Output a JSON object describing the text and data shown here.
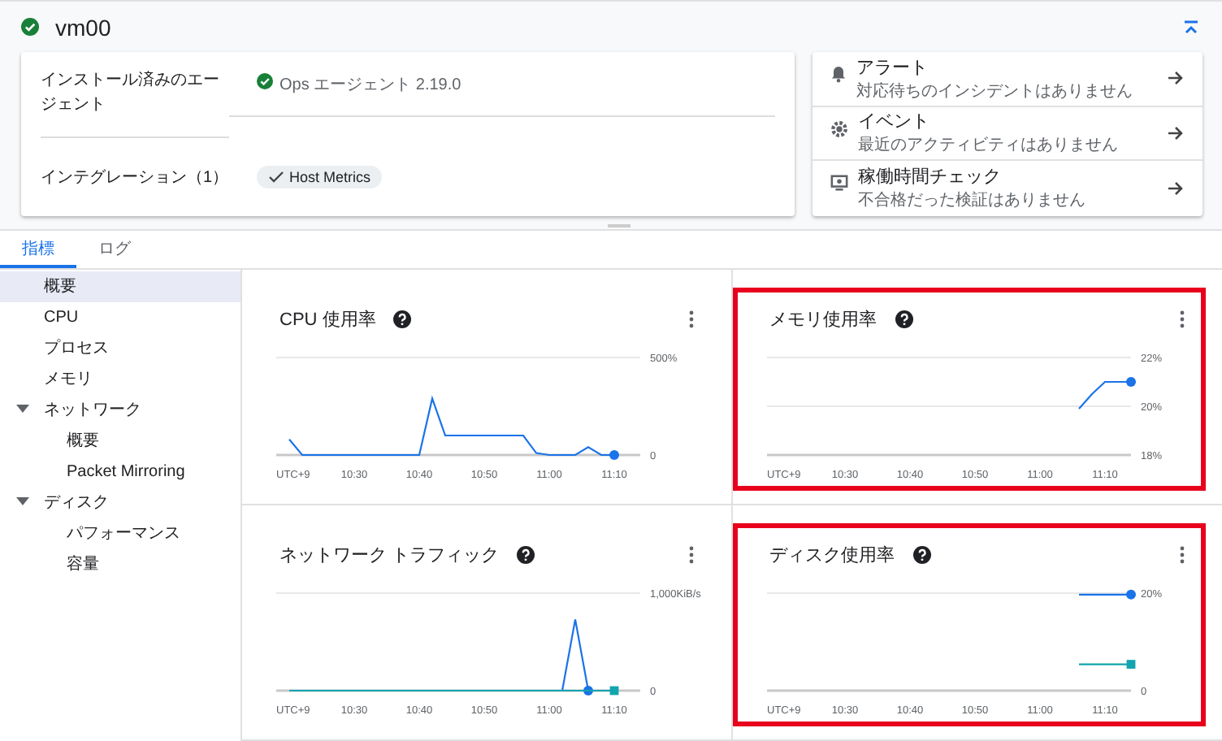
{
  "header": {
    "title": "vm00"
  },
  "agent_card": {
    "rows": [
      {
        "label": "インストール済みのエージェント",
        "value": "Ops エージェント 2.19.0"
      },
      {
        "label": "インテグレーション（1）",
        "chip": "Host Metrics"
      }
    ]
  },
  "summary_links": [
    {
      "kind": "alert",
      "title": "アラート",
      "subtitle": "対応待ちのインシデントはありません"
    },
    {
      "kind": "event",
      "title": "イベント",
      "subtitle": "最近のアクティビティはありません"
    },
    {
      "kind": "uptime",
      "title": "稼働時間チェック",
      "subtitle": "不合格だった検証はありません"
    }
  ],
  "tabs": [
    {
      "label": "指標",
      "selected": true
    },
    {
      "label": "ログ",
      "selected": false
    }
  ],
  "sidebar": {
    "items": [
      {
        "label": "概要",
        "selected": true
      },
      {
        "label": "CPU",
        "selected": false
      },
      {
        "label": "プロセス",
        "selected": false
      },
      {
        "label": "メモリ",
        "selected": false
      },
      {
        "label": "ネットワーク",
        "selected": false,
        "expanded": true,
        "children": [
          {
            "label": "概要",
            "selected": false
          },
          {
            "label": "Packet Mirroring",
            "selected": false
          }
        ]
      },
      {
        "label": "ディスク",
        "selected": false,
        "expanded": true,
        "children": [
          {
            "label": "パフォーマンス",
            "selected": false
          },
          {
            "label": "容量",
            "selected": false
          }
        ]
      }
    ]
  },
  "charts": [
    {
      "title": "CPU 使用率",
      "highlighted": false,
      "chart_data": {
        "type": "line",
        "xlabel": "UTC+9",
        "categories": [
          null,
          null,
          null,
          null,
          null,
          null,
          "10:30",
          null,
          null,
          null,
          null,
          "10:40",
          null,
          null,
          null,
          null,
          "10:50",
          null,
          null,
          null,
          null,
          "11:00",
          null,
          null,
          null,
          null,
          "11:10",
          null,
          null
        ],
        "series": [
          {
            "color": "#1a73e8",
            "values": [
              null,
              80,
              0,
              0,
              0,
              0,
              0,
              0,
              0,
              0,
              0,
              0,
              290,
              100,
              100,
              100,
              100,
              100,
              100,
              100,
              10,
              0,
              0,
              0,
              40,
              0,
              0,
              null,
              null
            ]
          }
        ],
        "ylim": [
          0,
          500
        ],
        "yticks": [
          {
            "value": 0,
            "label": "0"
          },
          {
            "value": 500,
            "label": "500%"
          }
        ]
      }
    },
    {
      "title": "メモリ使用率",
      "highlighted": true,
      "chart_data": {
        "type": "line",
        "xlabel": "UTC+9",
        "categories": [
          null,
          null,
          null,
          null,
          null,
          null,
          "10:30",
          null,
          null,
          null,
          null,
          "10:40",
          null,
          null,
          null,
          null,
          "10:50",
          null,
          null,
          null,
          null,
          "11:00",
          null,
          null,
          null,
          null,
          "11:10",
          null,
          null
        ],
        "series": [
          {
            "color": "#1a73e8",
            "values": [
              null,
              null,
              null,
              null,
              null,
              null,
              null,
              null,
              null,
              null,
              null,
              null,
              null,
              null,
              null,
              null,
              null,
              null,
              null,
              null,
              null,
              null,
              null,
              null,
              19.9,
              20.5,
              21,
              21,
              21
            ]
          }
        ],
        "ylim": [
          18,
          22
        ],
        "yticks": [
          {
            "value": 18,
            "label": "18%"
          },
          {
            "value": 20,
            "label": "20%"
          },
          {
            "value": 22,
            "label": "22%"
          }
        ]
      }
    },
    {
      "title": "ネットワーク トラフィック",
      "highlighted": false,
      "chart_data": {
        "type": "line",
        "xlabel": "UTC+9",
        "categories": [
          null,
          null,
          null,
          null,
          null,
          null,
          "10:30",
          null,
          null,
          null,
          null,
          "10:40",
          null,
          null,
          null,
          null,
          "10:50",
          null,
          null,
          null,
          null,
          "11:00",
          null,
          null,
          null,
          null,
          "11:10",
          null,
          null
        ],
        "series": [
          {
            "color": "#1a73e8",
            "values": [
              null,
              null,
              null,
              null,
              null,
              null,
              null,
              null,
              null,
              null,
              null,
              null,
              null,
              null,
              null,
              null,
              null,
              null,
              null,
              null,
              null,
              null,
              0,
              730,
              0,
              null,
              null,
              null,
              null
            ]
          },
          {
            "color": "#12a4af",
            "values": [
              null,
              0,
              0,
              0,
              0,
              0,
              0,
              0,
              0,
              0,
              0,
              0,
              0,
              0,
              0,
              0,
              0,
              0,
              0,
              0,
              0,
              0,
              0,
              0,
              0,
              0,
              0,
              null,
              null
            ]
          }
        ],
        "ylim": [
          0,
          1000
        ],
        "yticks": [
          {
            "value": 0,
            "label": "0"
          },
          {
            "value": 1000,
            "label": "1,000KiB/s"
          }
        ]
      }
    },
    {
      "title": "ディスク使用率",
      "highlighted": true,
      "chart_data": {
        "type": "line",
        "xlabel": "UTC+9",
        "categories": [
          null,
          null,
          null,
          null,
          null,
          null,
          "10:30",
          null,
          null,
          null,
          null,
          "10:40",
          null,
          null,
          null,
          null,
          "10:50",
          null,
          null,
          null,
          null,
          "11:00",
          null,
          null,
          null,
          null,
          "11:10",
          null,
          null
        ],
        "series": [
          {
            "color": "#1a73e8",
            "values": [
              null,
              null,
              null,
              null,
              null,
              null,
              null,
              null,
              null,
              null,
              null,
              null,
              null,
              null,
              null,
              null,
              null,
              null,
              null,
              null,
              null,
              null,
              null,
              null,
              19.7,
              19.7,
              19.7,
              19.7,
              19.7
            ]
          },
          {
            "color": "#12a4af",
            "values": [
              null,
              null,
              null,
              null,
              null,
              null,
              null,
              null,
              null,
              null,
              null,
              null,
              null,
              null,
              null,
              null,
              null,
              null,
              null,
              null,
              null,
              null,
              null,
              null,
              5.4,
              5.4,
              5.4,
              5.4,
              5.4
            ]
          }
        ],
        "ylim": [
          0,
          20
        ],
        "yticks": [
          {
            "value": 0,
            "label": "0"
          },
          {
            "value": 20,
            "label": "20%"
          }
        ]
      }
    }
  ]
}
